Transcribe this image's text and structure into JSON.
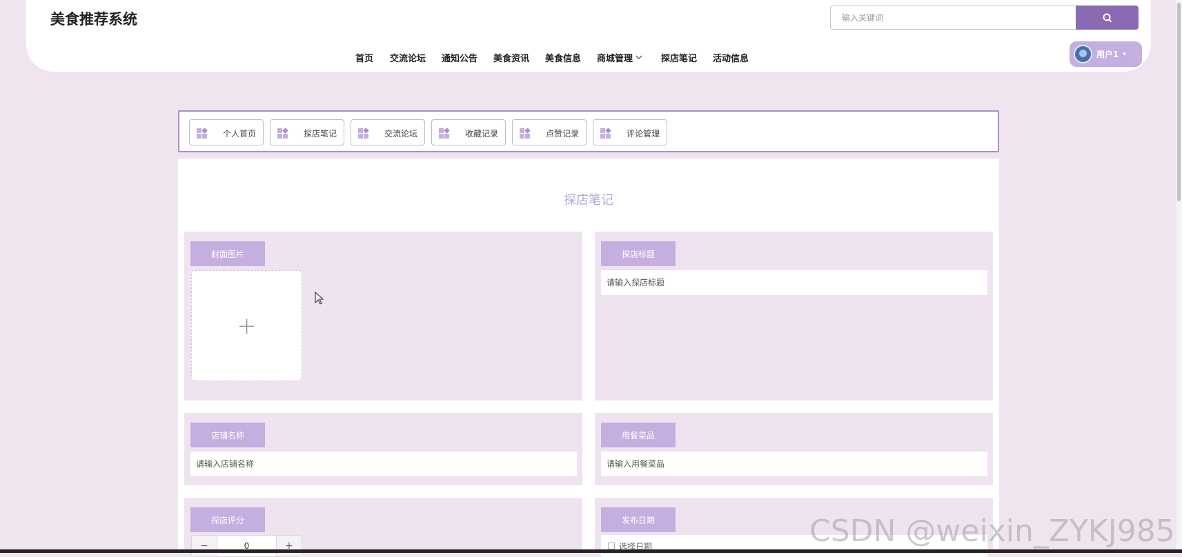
{
  "app": {
    "title": "美食推荐系统"
  },
  "search": {
    "placeholder": "输入关键词",
    "button_icon": "search-icon"
  },
  "nav": {
    "items": [
      {
        "label": "首页"
      },
      {
        "label": "交流论坛"
      },
      {
        "label": "通知公告"
      },
      {
        "label": "美食资讯"
      },
      {
        "label": "美食信息"
      },
      {
        "label": "商城管理",
        "has_dropdown": true
      },
      {
        "label": "探店笔记"
      },
      {
        "label": "活动信息"
      }
    ]
  },
  "user": {
    "label": "用户1"
  },
  "tabs": [
    {
      "label": "个人首页"
    },
    {
      "label": "探店笔记"
    },
    {
      "label": "交流论坛"
    },
    {
      "label": "收藏记录"
    },
    {
      "label": "点赞记录"
    },
    {
      "label": "评论管理"
    }
  ],
  "page": {
    "heading": "探店笔记"
  },
  "form": {
    "cover_image": {
      "label": "封面图片"
    },
    "title": {
      "label": "探店标题",
      "placeholder": "请输入探店标题"
    },
    "shop_name": {
      "label": "店铺名称",
      "placeholder": "请输入店铺名称"
    },
    "dishes": {
      "label": "用餐菜品",
      "placeholder": "请输入用餐菜品"
    },
    "rating": {
      "label": "探店评分",
      "value": "0",
      "minus": "−",
      "plus": "+"
    },
    "publish_date": {
      "label": "发布日期",
      "placeholder": "选择日期"
    }
  },
  "watermark": "CSDN @weixin_ZYKJ985",
  "colors": {
    "accent": "#8a6bb3",
    "label_bg": "#c5aee0",
    "page_bg": "#f0e5ef",
    "heading": "#b7a7d2"
  }
}
